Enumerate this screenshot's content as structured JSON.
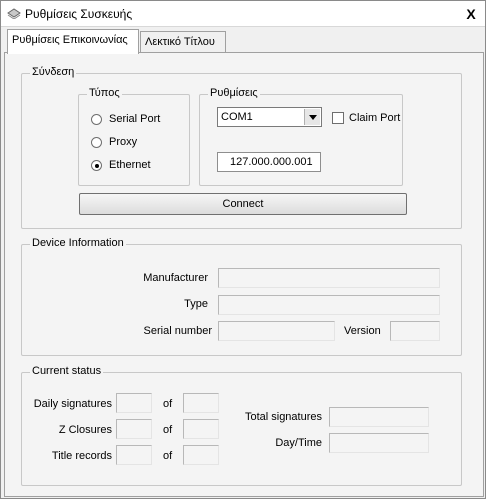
{
  "window": {
    "title": "Ρυθμίσεις Συσκευής",
    "close_label": "X"
  },
  "tabs": [
    {
      "label": "Ρυθμίσεις Επικοινωνίας",
      "active": true
    },
    {
      "label": "Λεκτικό Τίτλου",
      "active": false
    }
  ],
  "connection": {
    "legend": "Σύνδεση",
    "type_group": {
      "legend": "Τύπος",
      "options": [
        {
          "label": "Serial Port",
          "checked": false
        },
        {
          "label": "Proxy",
          "checked": false
        },
        {
          "label": "Ethernet",
          "checked": true
        }
      ]
    },
    "settings_group": {
      "legend": "Ρυθμίσεις",
      "port_value": "COM1",
      "claim_port_label": "Claim Port",
      "claim_port_checked": false,
      "ip_value": "127.000.000.001"
    },
    "connect_label": "Connect"
  },
  "device_info": {
    "legend": "Device Information",
    "manufacturer_label": "Manufacturer",
    "manufacturer_value": "",
    "type_label": "Type",
    "type_value": "",
    "serial_label": "Serial number",
    "serial_value": "",
    "version_label": "Version",
    "version_value": ""
  },
  "current_status": {
    "legend": "Current status",
    "rows": [
      {
        "label": "Daily signatures",
        "of": "of",
        "value": "",
        "total": ""
      },
      {
        "label": "Z Closures",
        "of": "of",
        "value": "",
        "total": ""
      },
      {
        "label": "Title records",
        "of": "of",
        "value": "",
        "total": ""
      }
    ],
    "total_signatures_label": "Total signatures",
    "total_signatures_value": "",
    "datetime_label": "Day/Time",
    "datetime_value": ""
  }
}
